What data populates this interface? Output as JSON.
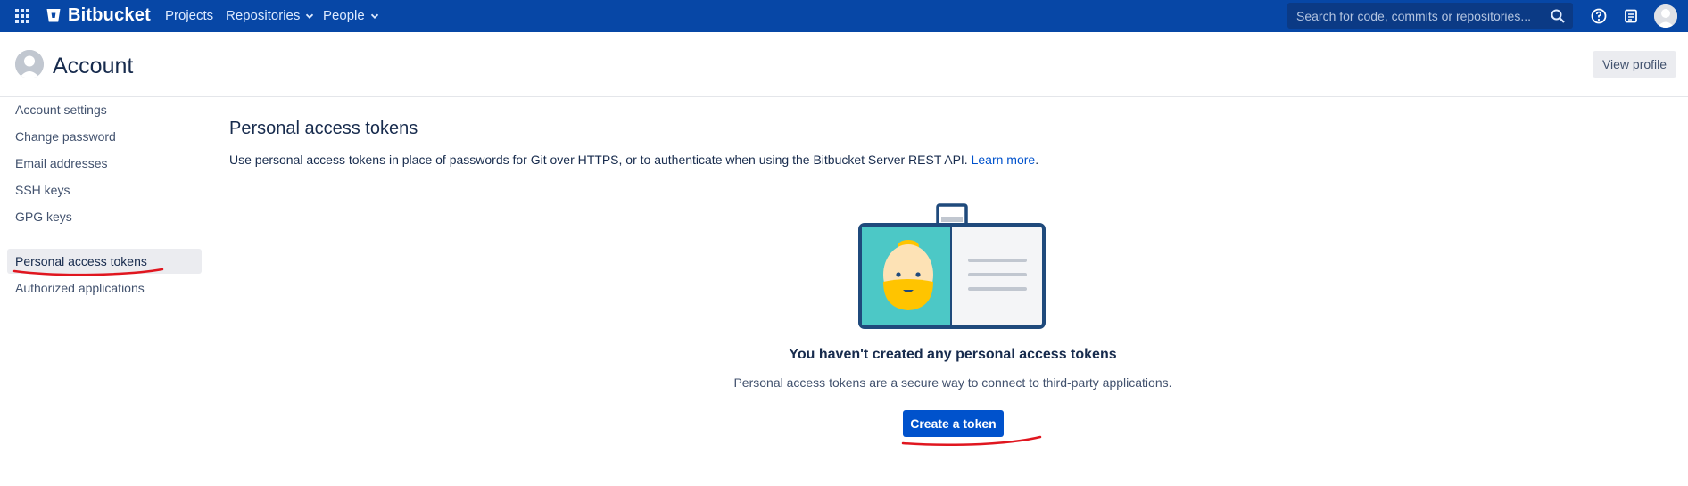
{
  "topnav": {
    "logo_text": "Bitbucket",
    "items": [
      {
        "label": "Projects"
      },
      {
        "label": "Repositories"
      },
      {
        "label": "People"
      }
    ],
    "search_placeholder": "Search for code, commits or repositories..."
  },
  "header": {
    "title": "Account",
    "view_profile_label": "View profile"
  },
  "sidebar": {
    "items": [
      {
        "label": "Account settings"
      },
      {
        "label": "Change password"
      },
      {
        "label": "Email addresses"
      },
      {
        "label": "SSH keys"
      },
      {
        "label": "GPG keys"
      },
      {
        "label": "Personal access tokens",
        "active": true
      },
      {
        "label": "Authorized applications"
      }
    ]
  },
  "main": {
    "title": "Personal access tokens",
    "description": "Use personal access tokens in place of passwords for Git over HTTPS, or to authenticate when using the Bitbucket Server REST API.",
    "learn_more": "Learn more",
    "learn_more_suffix": ".",
    "empty_title": "You haven't created any personal access tokens",
    "empty_description": "Personal access tokens are a secure way to connect to third-party applications.",
    "create_button": "Create a token"
  },
  "colors": {
    "nav_bg": "#0747a6",
    "primary": "#0052cc",
    "annotation": "#e0161f"
  }
}
